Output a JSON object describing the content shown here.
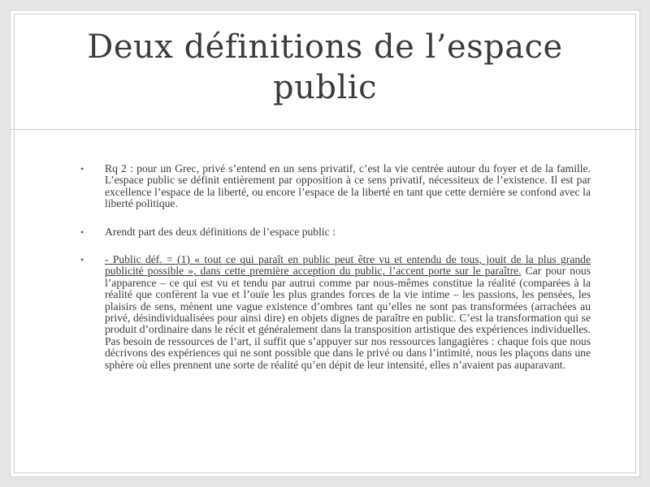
{
  "slide": {
    "title": "Deux définitions de l’espace public",
    "bullet_symbol": "•",
    "bullets": [
      {
        "text": "Rq 2 : pour un Grec, privé s’entend en un sens privatif, c’est la vie centrée autour du foyer et de la famille. L’espace public se définit entièrement par opposition à ce sens privatif, nécessiteux de l’existence. Il est par excellence l’espace de la liberté, ou encore l’espace de la liberté en tant que cette dernière se confond avec la liberté politique."
      },
      {
        "text": "Arendt part des deux définitions de l’espace public :"
      },
      {
        "underlined": "- Public déf. = (1)  « tout ce qui paraît en public peut être vu et entendu de tous, jouit de la plus grande publicité possible », dans cette première acception du public, l’accent porte sur le paraître.",
        "rest": " Car pour nous l’apparence – ce qui est vu et tendu par autrui comme par nous-mêmes constitue la réalité (comparées à la réalité que confèrent la vue et l’ouïe les plus grandes forces de la vie intime – les passions, les pensées, les plaisirs de sens, mènent une vague existence d’ombres tant qu’elles ne sont pas transformées (arrachées au privé, désindividualisées pour ainsi dire) en objets dignes de paraître en public. C’est la transformation qui se produit d’ordinaire dans le récit et généralement dans la transposition artistique des expériences individuelles. Pas besoin de ressources de l’art, il suffit que s’appuyer sur nos ressources langagières : chaque fois que nous décrivons des expériences qui ne sont possible que dans le privé ou dans l’intimité, nous les plaçons dans une sphère où elles prennent une sorte de réalité qu’en dépit de leur intensité, elles n’avaient pas auparavant."
      }
    ]
  }
}
